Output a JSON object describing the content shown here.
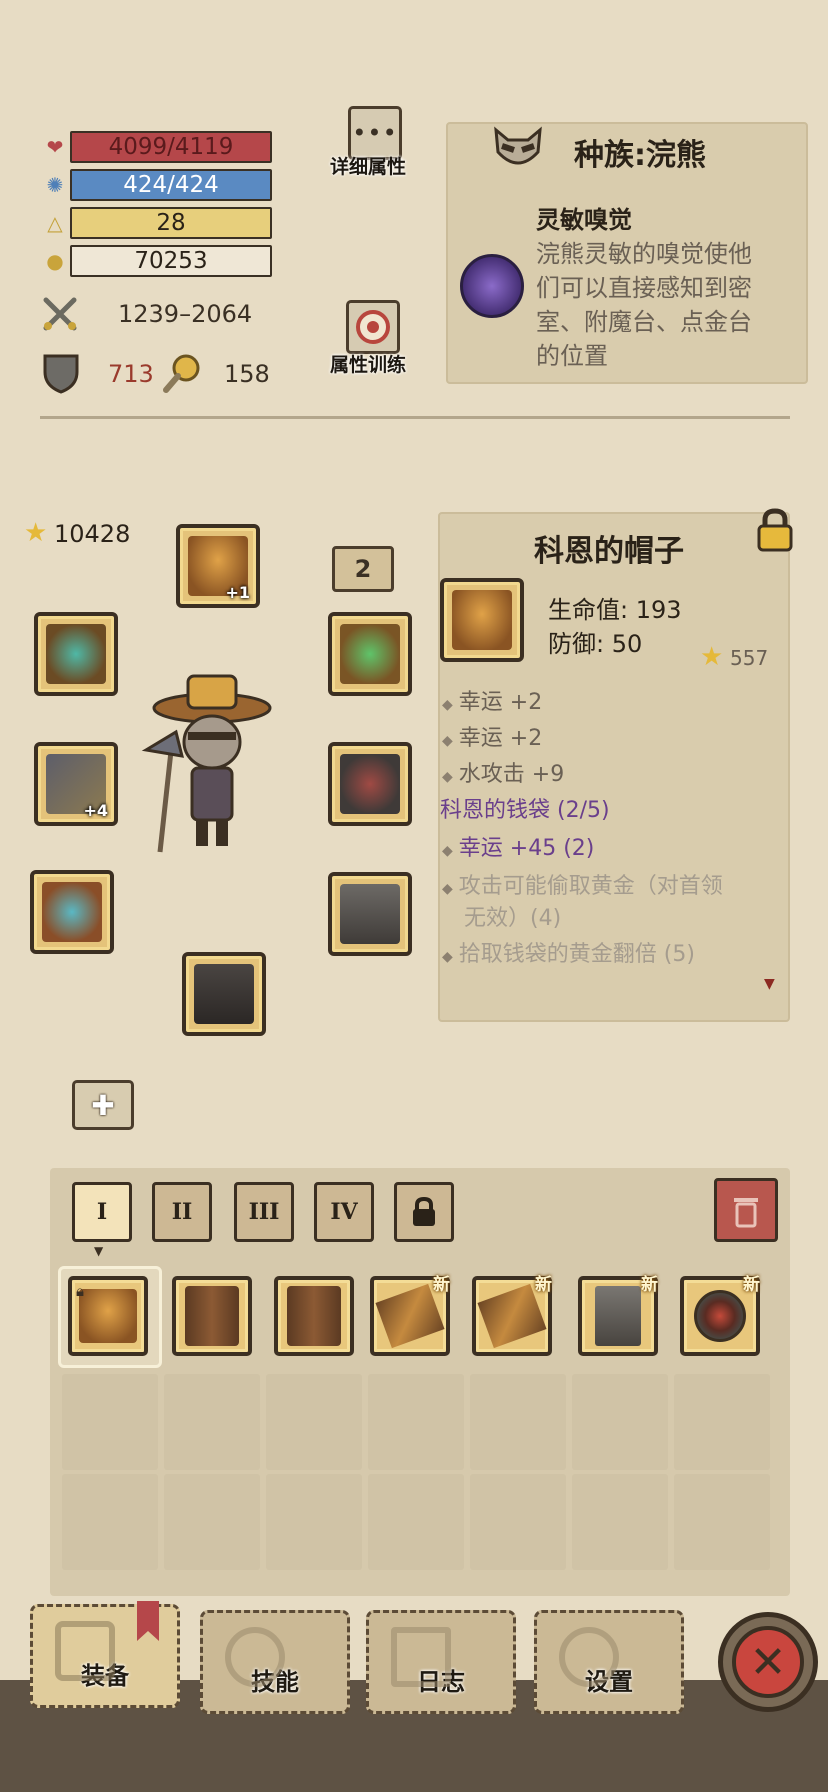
{
  "stats": {
    "hp": "4099/4119",
    "mp": "424/424",
    "level": "28",
    "gold": "70253",
    "attack": "1239–2064",
    "defense": "713",
    "luck": "158"
  },
  "buttons": {
    "detail_attributes": "详细属性",
    "attribute_training": "属性训练"
  },
  "race": {
    "title": "种族:浣熊",
    "trait_name": "灵敏嗅觉",
    "trait_desc_1": "浣熊灵敏的嗅觉使他",
    "trait_desc_2": "们可以直接感知到密",
    "trait_desc_3": "室、附魔台、点金台",
    "trait_desc_4": "的位置"
  },
  "equipment": {
    "score": "10428",
    "helmet_enhance": "+1",
    "weapon_enhance": "+4",
    "level_badge": "2"
  },
  "item_detail": {
    "name": "科恩的帽子",
    "stat_1": "生命值: 193",
    "stat_2": "防御: 50",
    "score": "557",
    "affixes": [
      "幸运 +2",
      "幸运 +2",
      "水攻击 +9"
    ],
    "set_name": "科恩的钱袋 (2/5)",
    "set_bonus_1": "幸运 +45 (2)",
    "set_bonus_2a": "攻击可能偷取黄金（对首领",
    "set_bonus_2b": "无效）(4)",
    "set_bonus_3": "拾取钱袋的黄金翻倍 (5)"
  },
  "inventory": {
    "tabs": [
      "I",
      "II",
      "III",
      "IV"
    ],
    "new_label": "新"
  },
  "nav": {
    "equipment": "装备",
    "skills": "技能",
    "journal": "日志",
    "settings": "设置"
  },
  "colors": {
    "background": "#e7dcc4",
    "hp_bar": "#b5474a",
    "mp_bar": "#5a8ac2",
    "level_bar": "#e7cf7c",
    "set_text": "#6a3f8c",
    "close_button": "#c9463e"
  }
}
